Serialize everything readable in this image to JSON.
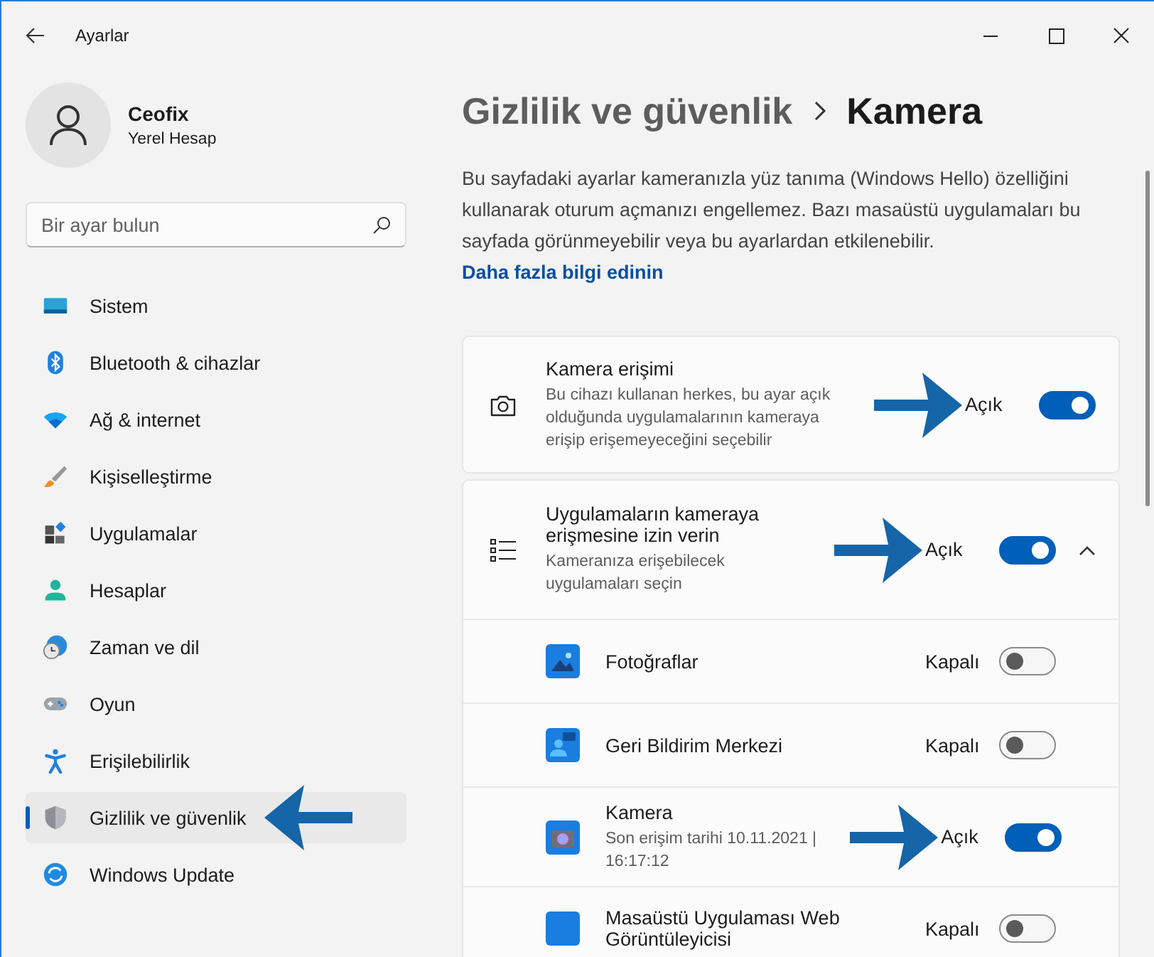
{
  "window": {
    "title": "Ayarlar"
  },
  "user": {
    "name": "Ceofix",
    "account": "Yerel Hesap"
  },
  "search": {
    "placeholder": "Bir ayar bulun"
  },
  "sidebar": {
    "items": [
      {
        "label": "Sistem",
        "selected": false,
        "annotated": false
      },
      {
        "label": "Bluetooth & cihazlar",
        "selected": false,
        "annotated": false
      },
      {
        "label": "Ağ & internet",
        "selected": false,
        "annotated": false
      },
      {
        "label": "Kişiselleştirme",
        "selected": false,
        "annotated": false
      },
      {
        "label": "Uygulamalar",
        "selected": false,
        "annotated": false
      },
      {
        "label": "Hesaplar",
        "selected": false,
        "annotated": false
      },
      {
        "label": "Zaman ve dil",
        "selected": false,
        "annotated": false
      },
      {
        "label": "Oyun",
        "selected": false,
        "annotated": false
      },
      {
        "label": "Erişilebilirlik",
        "selected": false,
        "annotated": false
      },
      {
        "label": "Gizlilik ve güvenlik",
        "selected": true,
        "annotated": true
      },
      {
        "label": "Windows Update",
        "selected": false,
        "annotated": false
      }
    ]
  },
  "breadcrumb": {
    "parent": "Gizlilik ve güvenlik",
    "current": "Kamera"
  },
  "description": {
    "text": "Bu sayfadaki ayarlar kameranızla yüz tanıma (Windows Hello) özelliğini kullanarak oturum açmanızı engellemez. Bazı masaüstü uygulamaları bu sayfada görünmeyebilir veya bu ayarlardan etkilenebilir.",
    "link": "Daha fazla bilgi edinin"
  },
  "camera_access": {
    "title": "Kamera erişimi",
    "subtitle": "Bu cihazı kullanan herkes, bu ayar açık olduğunda uygulamalarının kameraya erişip erişemeyeceğini seçebilir",
    "status": "Açık",
    "on": true,
    "annotated": true
  },
  "app_access": {
    "title": "Uygulamaların kameraya erişmesine izin verin",
    "subtitle": "Kameranıza erişebilecek uygulamaları seçin",
    "status": "Açık",
    "on": true,
    "annotated": true,
    "expanded": true,
    "apps": [
      {
        "name": "Fotoğraflar",
        "status": "Kapalı",
        "on": false,
        "annotated": false
      },
      {
        "name": "Geri Bildirim Merkezi",
        "status": "Kapalı",
        "on": false,
        "annotated": false
      },
      {
        "name": "Kamera",
        "detail": "Son erişim tarihi 10.11.2021 | 16:17:12",
        "status": "Açık",
        "on": true,
        "annotated": true
      },
      {
        "name": "Masaüstü Uygulaması Web Görüntüleyicisi",
        "status": "Kapalı",
        "on": false,
        "annotated": false
      }
    ]
  }
}
